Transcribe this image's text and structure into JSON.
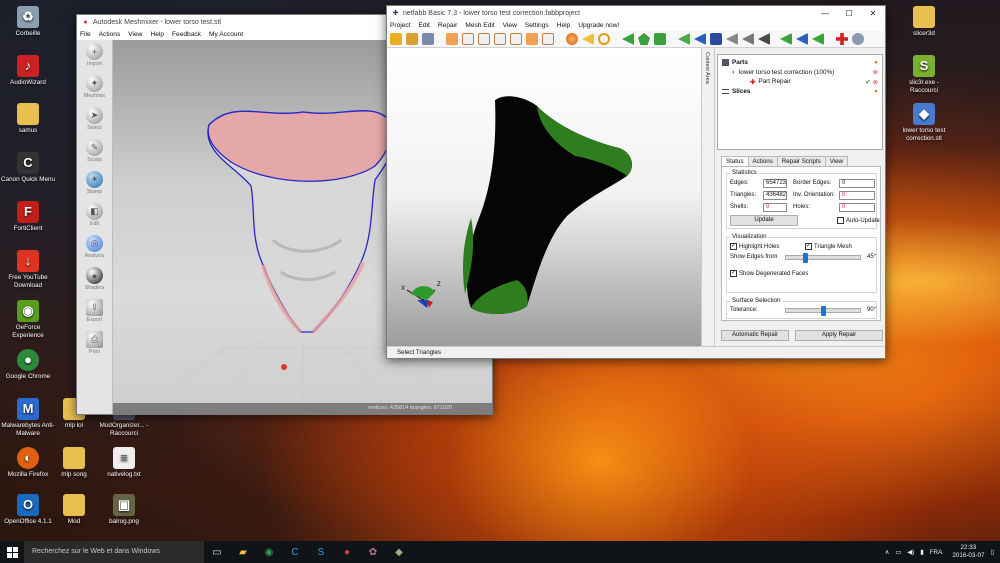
{
  "desktop": {
    "icons": [
      {
        "label": "Corbeille",
        "icon": "recycle-bin-icon",
        "color": "#8aa0b0"
      },
      {
        "label": "AudioWizard",
        "icon": "audio-wizard-icon",
        "color": "#c22"
      },
      {
        "label": "samus",
        "icon": "folder-icon",
        "color": "#e8c050"
      },
      {
        "label": "Canon Quick Menu",
        "icon": "canon-icon",
        "color": "#333"
      },
      {
        "label": "FortiClient",
        "icon": "forticlient-icon",
        "color": "#c0201a"
      },
      {
        "label": "Free YouTube Download",
        "icon": "download-icon",
        "color": "#d32"
      },
      {
        "label": "GeForce Experience",
        "icon": "nvidia-icon",
        "color": "#5a9e1e"
      },
      {
        "label": "Google Chrome",
        "icon": "chrome-icon",
        "color": "#2a8a3a"
      },
      {
        "label": "Malwarebytes Anti-Malware",
        "icon": "malwarebytes-icon",
        "color": "#2a6ad0"
      },
      {
        "label": "Mozilla Firefox",
        "icon": "firefox-icon",
        "color": "#e06010"
      },
      {
        "label": "OpenOffice 4.1.1",
        "icon": "openoffice-icon",
        "color": "#1a6ac0"
      },
      {
        "label": "mlp lol",
        "icon": "folder-icon",
        "color": "#e8c050"
      },
      {
        "label": "mlp song",
        "icon": "folder-icon",
        "color": "#e8c050"
      },
      {
        "label": "Mod",
        "icon": "folder-icon",
        "color": "#e8c050"
      },
      {
        "label": "ModOrganizer... - Raccourci",
        "icon": "shortcut-icon",
        "color": "#556"
      },
      {
        "label": "nativelog.txt",
        "icon": "text-file-icon",
        "color": "#eee"
      },
      {
        "label": "balrog.png",
        "icon": "image-file-icon",
        "color": "#664"
      },
      {
        "label": "slicer3d",
        "icon": "folder-icon",
        "color": "#e8c050"
      },
      {
        "label": "slic3r.exe - Raccourci",
        "icon": "slic3r-icon",
        "color": "#7ab030"
      },
      {
        "label": "lower torso test correction.stl",
        "icon": "stl-file-icon",
        "color": "#4a7ad0"
      }
    ]
  },
  "meshmixer": {
    "title": "Autodesk Meshmixer - lower torso test.stl",
    "menu": [
      "File",
      "Actions",
      "View",
      "Help",
      "Feedback",
      "My Account"
    ],
    "tools": [
      {
        "label": "Import",
        "icon": "import-icon"
      },
      {
        "label": "Meshmix",
        "icon": "meshmix-icon"
      },
      {
        "label": "Select",
        "icon": "select-icon"
      },
      {
        "label": "Sculpt",
        "icon": "sculpt-icon"
      },
      {
        "label": "Stamp",
        "icon": "stamp-icon"
      },
      {
        "label": "Edit",
        "icon": "edit-icon"
      },
      {
        "label": "Analysis",
        "icon": "analysis-icon"
      },
      {
        "label": "Shaders",
        "icon": "shaders-icon"
      },
      {
        "label": "Export",
        "icon": "export-icon"
      },
      {
        "label": "Print",
        "icon": "print-icon"
      }
    ],
    "status": "vertices: 435814  triangles: 871520"
  },
  "netfabb": {
    "title": "netfabb Basic 7.3 - lower torso test correction.fabbproject",
    "menu": [
      "Project",
      "Edit",
      "Repair",
      "Mesh Edit",
      "View",
      "Settings",
      "Help",
      "Upgrade now!"
    ],
    "context_tab": "Context Area",
    "tree": {
      "parts": "Parts",
      "part_name": "lower torso test correction (100%)",
      "repair": "Part Repair",
      "slices": "Slices"
    },
    "tabs": [
      "Status",
      "Actions",
      "Repair Scripts",
      "View"
    ],
    "statistics": {
      "title": "Statistics",
      "edges_label": "Edges:",
      "edges": "654723",
      "border_edges_label": "Border Edges:",
      "border_edges": "0",
      "triangles_label": "Triangles:",
      "triangles": "436482",
      "inv_orientation_label": "Inv. Orientation:",
      "inv_orientation": "0",
      "shells_label": "Shells:",
      "shells": "0",
      "holes_label": "Holes:",
      "holes": "0",
      "update": "Update",
      "auto_update": "Auto-Update"
    },
    "visualization": {
      "title": "Visualization",
      "highlight_holes": "Highlight Holes",
      "triangle_mesh": "Triangle Mesh",
      "show_edges_from": "Show Edges from",
      "edges_angle": "45°",
      "edges_level": 0.25,
      "show_degenerated": "Show Degenerated Faces"
    },
    "surface": {
      "title": "Surface Selection",
      "tolerance_label": "Tolerance:",
      "tolerance": "90°",
      "tolerance_level": 0.5
    },
    "automatic_repair": "Automatic Repair",
    "apply_repair": "Apply Repair",
    "status": "Select Triangles"
  },
  "taskbar": {
    "search_placeholder": "Recherchez sur le Web et dans Windows",
    "lang": "FRA",
    "time": "22:33",
    "date": "2016-03-07"
  },
  "colors": {
    "accent": "#1e74d0",
    "mesh_green": "#2e7d1f",
    "mesh_highlight": "#e8a0a0",
    "outline": "#2727c8"
  }
}
